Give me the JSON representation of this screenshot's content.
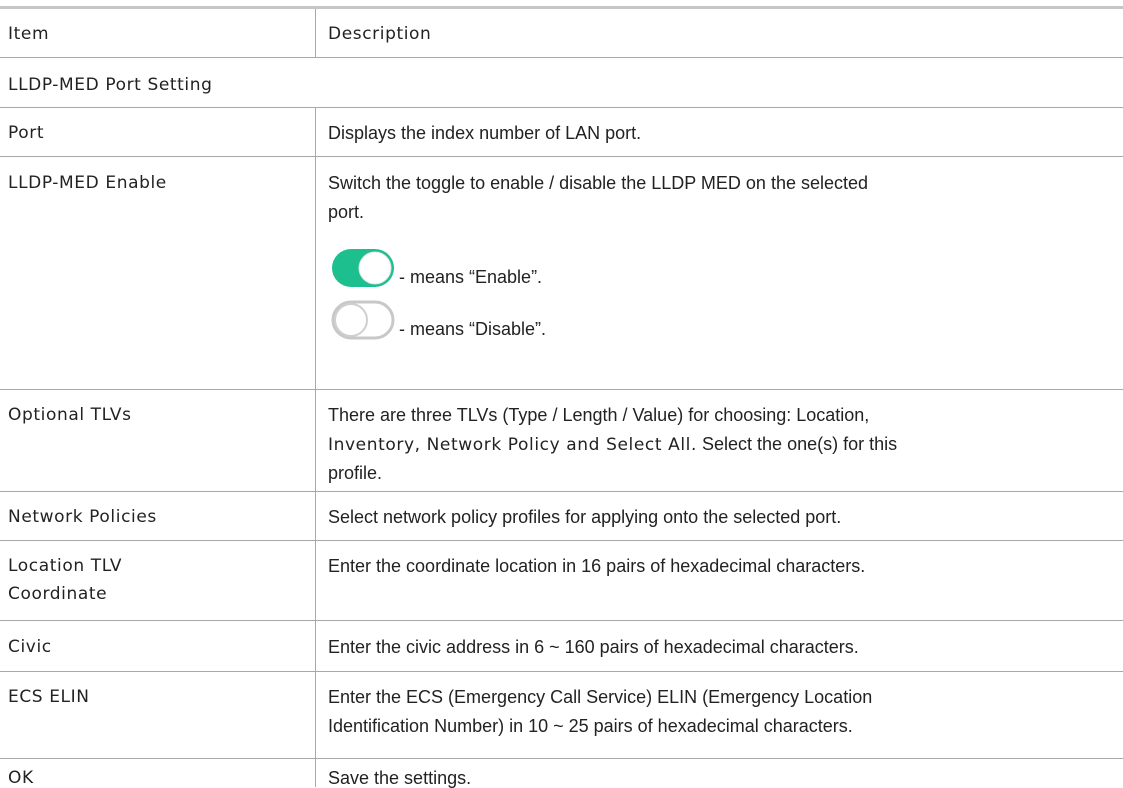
{
  "header": {
    "item": "Item",
    "description": "Description"
  },
  "section_title": "LLDP-MED Port Setting",
  "rows": [
    {
      "item": "Port",
      "description": "Displays the index number of LAN port."
    },
    {
      "item": "LLDP-MED Enable",
      "description_1": "Switch the toggle to enable / disable the LLDP MED on the selected",
      "description_2": "port.",
      "toggle_on_text": "- means “Enable”.",
      "toggle_off_text": "- means “Disable”."
    },
    {
      "item": "Optional TLVs",
      "description_1a": "There are three TLVs (Type / Length / Value) for choosing: Location,",
      "description_2a": "Inventory, Network Policy and Select All.",
      "description_2b": " Select the one(s) for this",
      "description_3": "profile."
    },
    {
      "item": "Network Policies",
      "description": "Select network policy profiles for applying onto the selected port."
    },
    {
      "item_1": "Location TLV",
      "item_2": "Coordinate",
      "description": "Enter the coordinate location in 16 pairs of hexadecimal characters."
    },
    {
      "item": "Civic",
      "description": "Enter the civic address in 6 ~ 160 pairs of hexadecimal characters."
    },
    {
      "item": "ECS ELIN",
      "description_1": "Enter the ECS (Emergency Call Service) ELIN (Emergency Location",
      "description_2": "Identification Number) in 10 ~ 25 pairs of hexadecimal characters."
    },
    {
      "item": "OK",
      "description": "Save the settings."
    }
  ],
  "colors": {
    "toggle_on": "#1dbf8e",
    "toggle_off_border": "#c8c8c8",
    "rule": "#a8a8a8"
  },
  "icons": {
    "toggle_on": "toggle-on-icon",
    "toggle_off": "toggle-off-icon"
  }
}
